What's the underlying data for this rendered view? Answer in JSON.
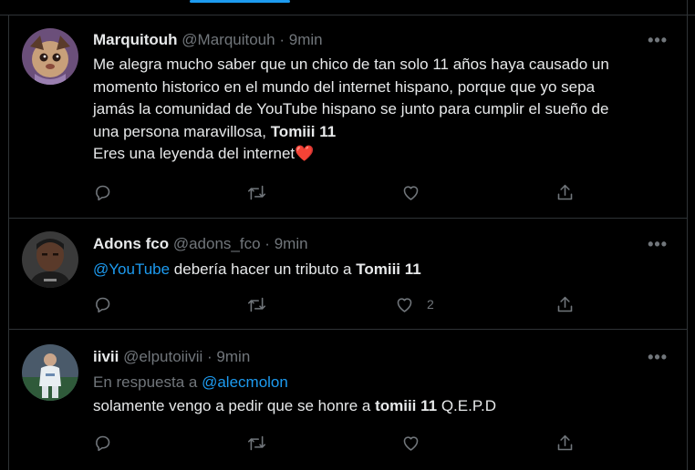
{
  "tweets": [
    {
      "name": "Marquitouh",
      "handle": "@Marquitouh",
      "sep": "·",
      "time": "9min",
      "more": "•••",
      "lines": [
        "Me alegra mucho saber que un chico de tan solo 11 años haya causado un",
        "momento historico en el mundo del internet hispano, porque que yo sepa",
        "jamás la comunidad de YouTube hispano se junto para cumplir el sueño de",
        "una persona maravillosa,"
      ],
      "bold_tag": "Tomiii 11",
      "last_line": "Eres una leyenda del internet",
      "heart_emoji": "❤️"
    },
    {
      "name": "Adons fco",
      "handle": "@adons_fco",
      "sep": "·",
      "time": "9min",
      "more": "•••",
      "mention": "@YouTube",
      "text": "debería hacer un tributo a",
      "bold_tag": "Tomiii 11",
      "like_count": "2"
    },
    {
      "name": "iivii",
      "handle": "@elputoiivii",
      "sep": "·",
      "time": "9min",
      "more": "•••",
      "reply_prefix": "En respuesta a",
      "reply_to": "@alecmolon",
      "text": "solamente vengo a pedir que se honre a",
      "bold_tag": "tomiii 11",
      "suffix": "Q.E.P.D"
    }
  ],
  "colors": {
    "accent": "#1d9bf0",
    "muted": "#71767b",
    "text": "#e7e9ea",
    "border": "#2f3336",
    "heart": "#e0245e"
  },
  "icons": [
    "reply-icon",
    "retweet-icon",
    "like-icon",
    "share-icon",
    "more-icon"
  ]
}
